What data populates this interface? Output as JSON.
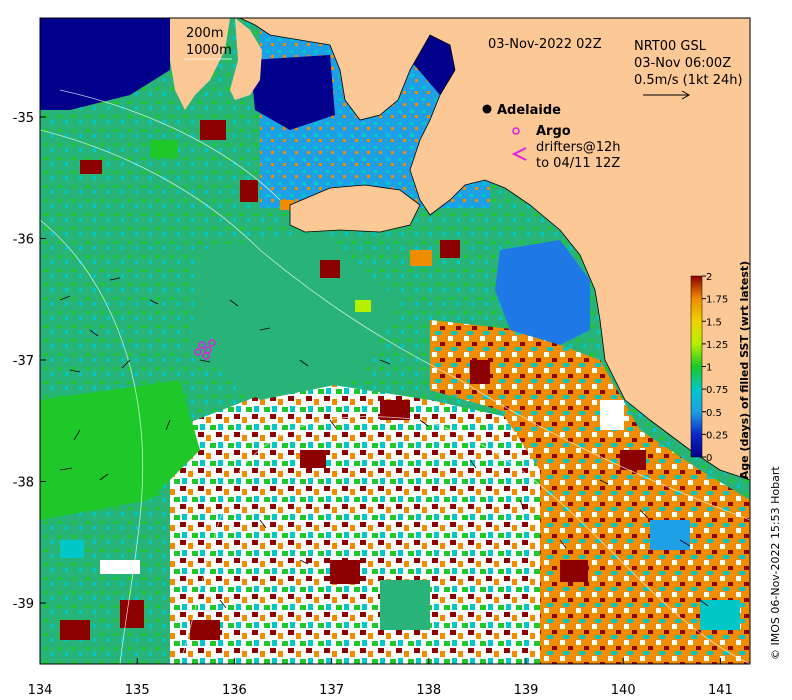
{
  "map": {
    "timestamp": "03-Nov-2022 02Z",
    "product_lines": [
      "NRT00 GSL",
      "03-Nov 06:00Z",
      "0.5m/s (1kt 24h)"
    ],
    "depth_labels": [
      "200m",
      "1000m"
    ],
    "place": "Adelaide",
    "legend": {
      "argo": "Argo",
      "drifters_line1": "drifters@12h",
      "drifters_line2": "to 04/11 12Z",
      "argo_color": "#e020e0",
      "drifter_color": "#e020e0"
    },
    "x_ticks": [
      "134",
      "135",
      "136",
      "137",
      "138",
      "139",
      "140",
      "141"
    ],
    "y_ticks": [
      "-35",
      "-36",
      "-37",
      "-38",
      "-39"
    ],
    "colorbar": {
      "label": "Age (days) of filled SST (wrt latest)",
      "ticks": [
        "0",
        "0.25",
        "0.5",
        "0.75",
        "1",
        "1.25",
        "1.5",
        "1.75",
        "2"
      ],
      "min": 0,
      "max": 2
    },
    "credit": "© IMOS 06-Nov-2022 15:53 Hobart",
    "colors": {
      "land": "#fcc896",
      "cloud": "#ffffff",
      "age_0": "#00008c",
      "age_025": "#0a28c8",
      "age_05": "#1ea0e6",
      "age_075": "#00c8c8",
      "age_1": "#1ec828",
      "age_125": "#b4f000",
      "age_15": "#f0d200",
      "age_175": "#f08c00",
      "age_2": "#8c0000"
    }
  }
}
